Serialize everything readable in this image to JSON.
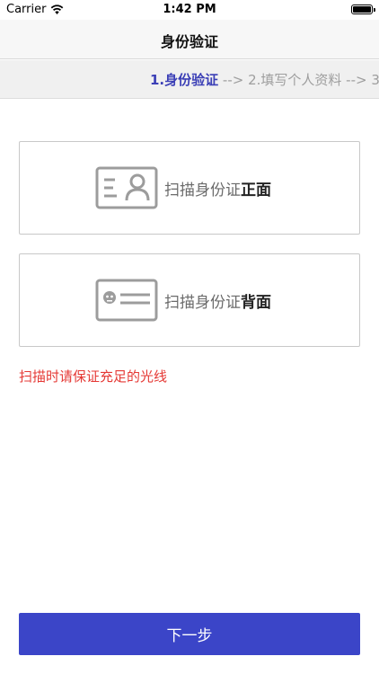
{
  "status_bar": {
    "carrier": "Carrier",
    "time": "1:42 PM",
    "battery_level": 1.0
  },
  "nav": {
    "title": "身份验证"
  },
  "steps": {
    "step1": "1.身份验证",
    "arrow1": " --> ",
    "step2": "2.填写个人资料",
    "arrow2": " --> ",
    "step3": "3"
  },
  "scan_front": {
    "prefix": "扫描身份证",
    "emphasis": "正面",
    "icon": "id-card-front-icon"
  },
  "scan_back": {
    "prefix": "扫描身份证",
    "emphasis": "背面",
    "icon": "id-card-back-icon"
  },
  "hint": "扫描时请保证充足的光线",
  "next_button": "下一步",
  "colors": {
    "accent": "#3b45c8",
    "step_active": "#3b3fb6",
    "hint": "#e53935"
  }
}
